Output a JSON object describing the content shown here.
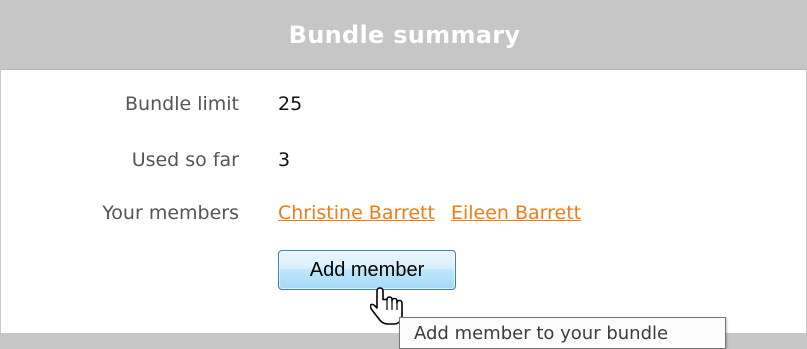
{
  "header": {
    "title": "Bundle summary"
  },
  "rows": {
    "limit": {
      "label": "Bundle limit",
      "value": "25"
    },
    "used": {
      "label": "Used so far",
      "value": "3"
    },
    "members": {
      "label": "Your members",
      "items": [
        "Christine Barrett",
        "Eileen Barrett"
      ]
    }
  },
  "actions": {
    "add_member_label": "Add member"
  },
  "tooltip": {
    "text": "Add member to your bundle"
  },
  "colors": {
    "header_bg": "#c6c6c6",
    "link": "#f07d12",
    "button_border": "#3c7fb1"
  },
  "icons": {
    "cursor": "hand-pointer-icon"
  }
}
